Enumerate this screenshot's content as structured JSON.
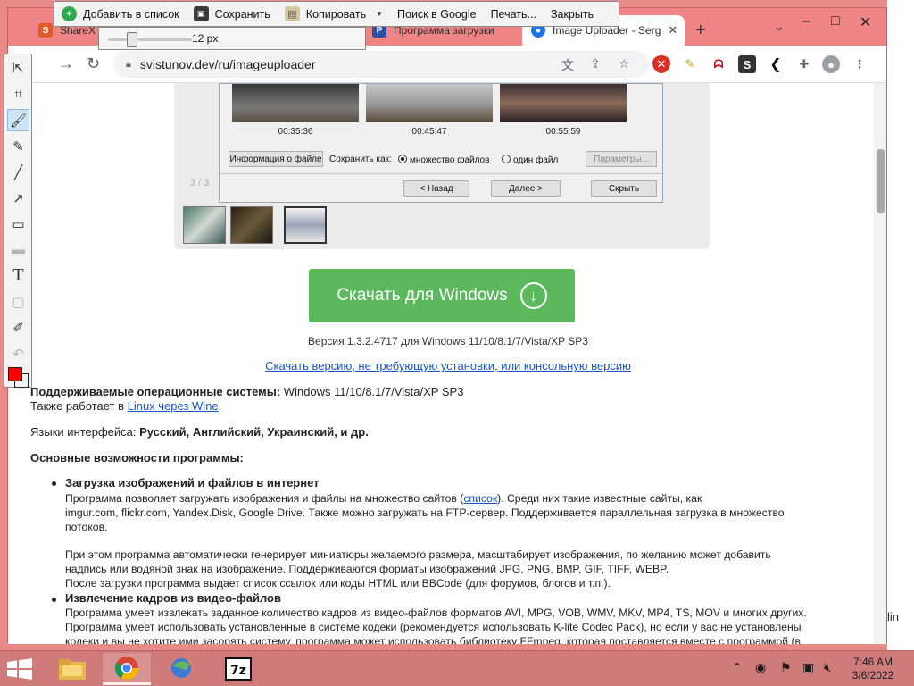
{
  "sharex_toolbar": {
    "actions": [
      {
        "label": "Добавить в список",
        "icon": "add-icon"
      },
      {
        "label": "Сохранить",
        "icon": "save-icon"
      },
      {
        "label": "Копировать",
        "icon": "copy-icon"
      },
      {
        "label": "Поиск в Google",
        "icon": "search-icon"
      },
      {
        "label": "Печать...",
        "icon": "print-icon"
      },
      {
        "label": "Закрыть",
        "icon": "close-icon"
      }
    ],
    "size_value": "12 px",
    "size_level": 0.26,
    "tools": [
      "select-icon",
      "crop-icon",
      "brush-icon",
      "marker-icon",
      "line-icon",
      "arrow-icon",
      "rectangle-icon",
      "blur-icon",
      "text-icon",
      "eraser-icon",
      "pipette-icon",
      "undo-icon"
    ],
    "fg_color": "#ff0000"
  },
  "browser": {
    "tabs": [
      {
        "title": "ShareX d",
        "favicon_color": "#e05a2a"
      },
      {
        "title": "Программа загрузки",
        "favicon_color": "#2a4fa6"
      },
      {
        "title": "Image Uploader - Serg",
        "favicon_color": "#1a73e8"
      }
    ],
    "url": "svistunov.dev/ru/imageuploader",
    "window_controls": {
      "minimize": "–",
      "maximize": "□",
      "close": "✕"
    }
  },
  "dialog": {
    "timestamps": [
      "00:35:36",
      "00:45:47",
      "00:55:59"
    ],
    "file_info_button": "Информация о файле",
    "save_as_label": "Сохранить как:",
    "option_many": "множество файлов",
    "option_one": "один файл",
    "params_button": "Параметры...",
    "back_button": "< Назад",
    "next_button": "Далее >",
    "hide_button": "Скрыть",
    "step": "3 / 3"
  },
  "page": {
    "download_button": "Скачать для Windows",
    "version": "Версия 1.3.2.4717 для Windows 11/10/8.1/7/Vista/XP SP3",
    "portable_link": "Скачать версию, не требующую установки, или консольную версию",
    "os_label": "Поддерживаемые операционные системы:",
    "os_value": " Windows 11/10/8.1/7/Vista/XP SP3",
    "linux_prefix": "Также работает в ",
    "linux_link": "Linux через Wine",
    "linux_suffix": ".",
    "lang_label": "Языки интерфейса: ",
    "lang_value": "Русский, Английский, Украинский, и др.",
    "features_heading": "Основные возможности программы:",
    "feature1_title": "Загрузка изображений и файлов в интернет",
    "feature1_l1_a": "Программа позволяет загружать изображения и файлы на множество сайтов  (",
    "feature1_l1_link": "список",
    "feature1_l1_b": "). Среди них такие известные сайты, как",
    "feature1_l2": "imgur.com, flickr.com, Yandex.Disk, Google Drive. Также можно загружать на FTP-сервер. Поддерживается параллельная загрузка в множество",
    "feature1_l3": "потоков.",
    "feature1_l4": "При этом программа автоматически генерирует миниатюры желаемого размера, масштабирует изображения, по желанию может добавить",
    "feature1_l5": "надпись или водяной знак на изображение. Поддерживаются форматы изображений JPG, PNG, BMP, GIF, TIFF, WEBP.",
    "feature1_l6": "После загрузки программа выдает список ссылок или коды HTML или BBCode (для форумов, блогов и т.п.).",
    "feature2_title": "Извлечение кадров из видео-файлов",
    "feature2_l1": "Программа умеет извлекать заданное количество кадров из видео-файлов форматов AVI, MPG, VOB, WMV, MKV, MP4, TS, MOV и многих других.",
    "feature2_l2": "Программа умеет использовать установленные в системе кодеки (рекомендуется использовать K-lite Codec Pack), но если у вас не установлены",
    "feature2_l3": "кодеки и вы не хотите ими засорять систему, программа может использовать библиотеку FFmpeg, которая поставляется вместе с программой (в"
  },
  "desktop": {
    "edge_fragment": "lin"
  },
  "taskbar": {
    "apps": [
      "explorer-icon",
      "chrome-icon",
      "image-uploader-icon",
      "7zip-icon"
    ],
    "time": "7:46 AM",
    "date": "3/6/2022"
  }
}
